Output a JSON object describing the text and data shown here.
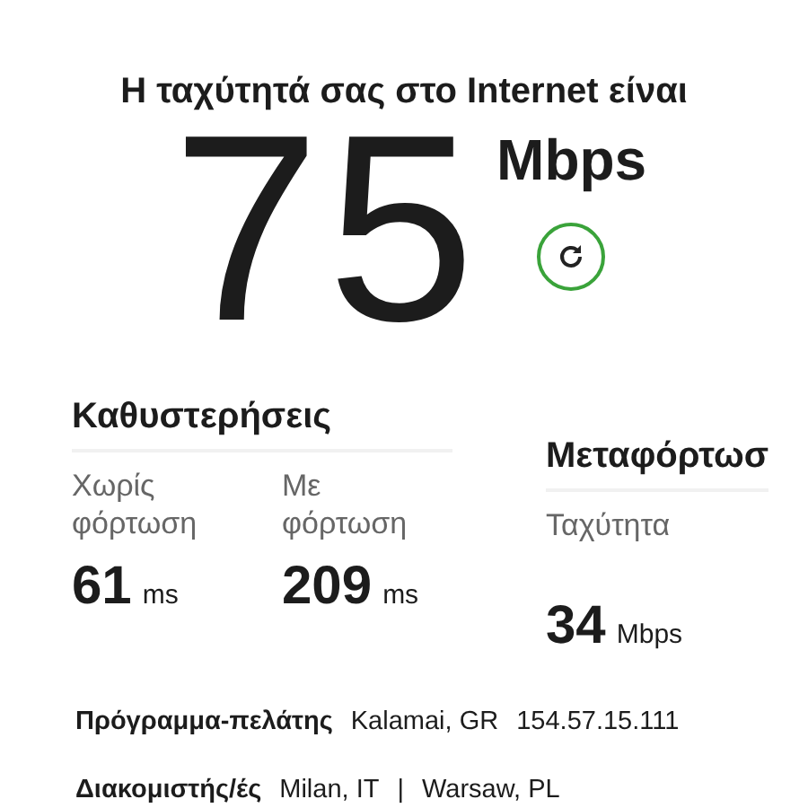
{
  "heading": "Η ταχύτητά σας στο Internet είναι",
  "speed": {
    "value": "75",
    "unit": "Mbps"
  },
  "latency": {
    "title": "Καθυστερήσεις",
    "metrics": [
      {
        "label": "Χωρίς φόρτωση",
        "value": "61",
        "unit": "ms"
      },
      {
        "label": "Με φόρτωση",
        "value": "209",
        "unit": "ms"
      }
    ]
  },
  "upload": {
    "title": "Μεταφόρτωσ",
    "metrics": [
      {
        "label": "Ταχύτητα",
        "value": "34",
        "unit": "Mbps"
      }
    ]
  },
  "client": {
    "label": "Πρόγραμμα-πελάτης",
    "values": [
      "Kalamai, GR",
      "154.57.15.111"
    ]
  },
  "servers": {
    "label": "Διακομιστής/ές",
    "values": [
      "Milan, IT",
      "|",
      "Warsaw, PL"
    ]
  }
}
